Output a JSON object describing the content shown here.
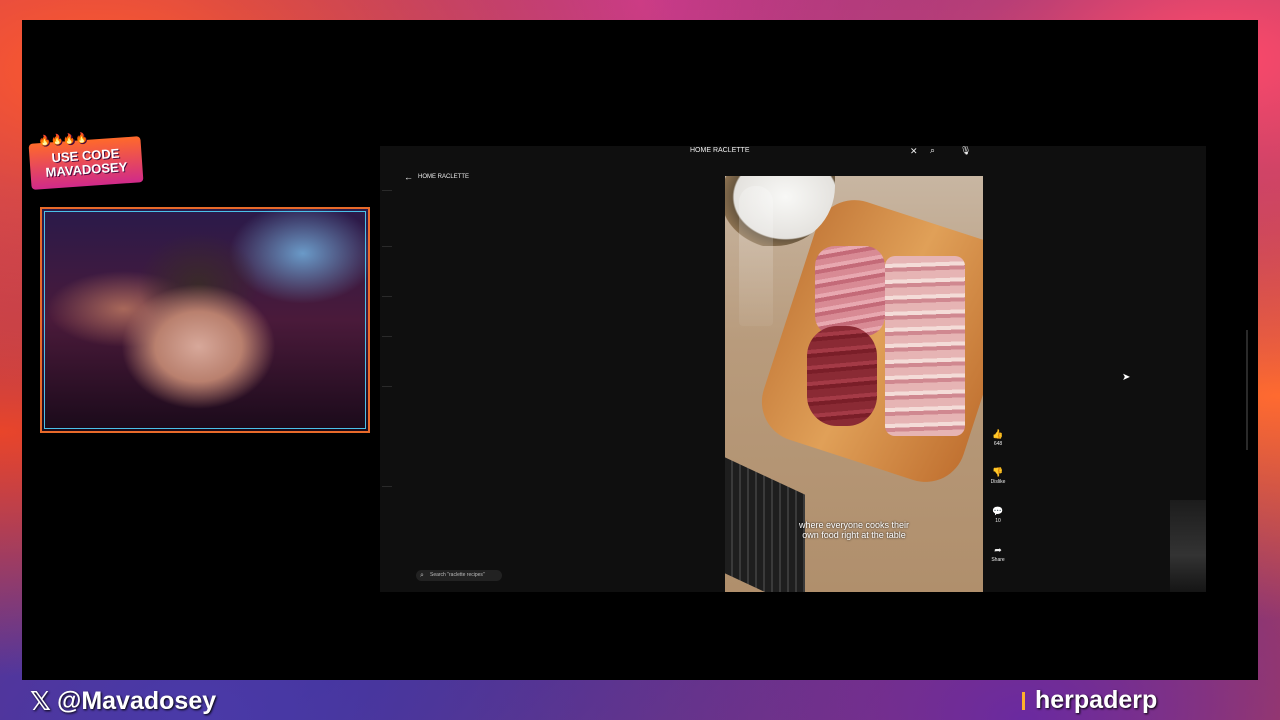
{
  "overlay": {
    "promo_line1": "USE CODE",
    "promo_line2": "MAVADOSEY",
    "x_handle": "@Mavadosey",
    "twitch_handle": "herpaderp",
    "accent_color": "#e86a2a"
  },
  "browser": {
    "search_query": "HOME RACLETTE",
    "back_label": "HOME RACLETTE",
    "bottom_search_placeholder": "Search \"raclette recipes\""
  },
  "video": {
    "caption_line1": "where everyone cooks their",
    "caption_line2": "own food right at the table"
  },
  "actions": {
    "like_count": "648",
    "dislike_label": "Dislike",
    "comment_count": "10",
    "share_label": "Share"
  },
  "icons": {
    "close": "close-icon",
    "search": "search-icon",
    "mic": "mic-icon",
    "back": "back-arrow-icon",
    "like": "thumbs-up-icon",
    "dislike": "thumbs-down-icon",
    "comment": "comment-icon",
    "share": "share-icon"
  }
}
